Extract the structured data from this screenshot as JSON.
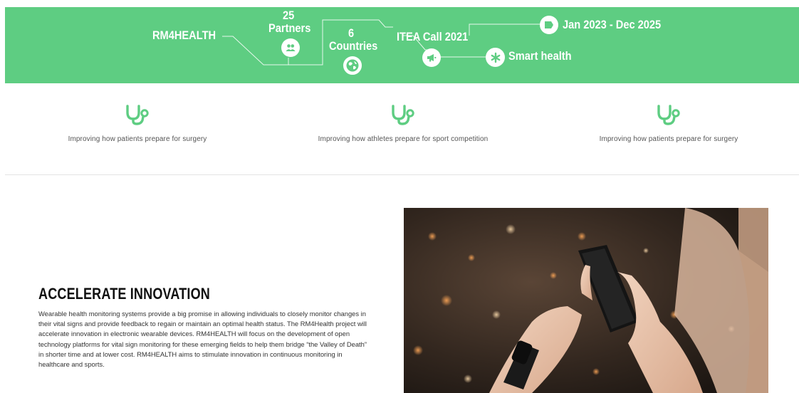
{
  "banner": {
    "project": "RM4HEALTH",
    "partners_count": "25",
    "partners_label": "Partners",
    "countries_count": "6",
    "countries_label": "Countries",
    "call": "ITEA Call 2021",
    "period": "Jan 2023 - Dec 2025",
    "topic": "Smart health",
    "icons": [
      "people-icon",
      "globe-icon",
      "megaphone-icon",
      "flag-icon",
      "asterisk-icon"
    ]
  },
  "features": [
    {
      "icon": "stethoscope-icon",
      "text": "Improving how patients prepare for surgery"
    },
    {
      "icon": "stethoscope-icon",
      "text": "Improving how athletes prepare for sport competition"
    },
    {
      "icon": "stethoscope-icon",
      "text": "Improving how patients prepare for surgery"
    }
  ],
  "section": {
    "heading": "ACCELERATE INNOVATION",
    "body": "Wearable health monitoring systems provide a big promise in allowing individuals to closely monitor changes in their vital signs and provide feedback to regain or maintain an optimal health status. The RM4Health project will accelerate innovation in electronic wearable devices. RM4HEALTH will focus on the development of open technology platforms for vital sign monitoring for these emerging fields to help them bridge “the Valley of Death” in shorter time and at lower cost. RM4HEALTH aims to stimulate innovation in continuous monitoring in healthcare and sports."
  },
  "colors": {
    "brand_green": "#5ecd82",
    "heading": "#111111",
    "text": "#555555"
  }
}
